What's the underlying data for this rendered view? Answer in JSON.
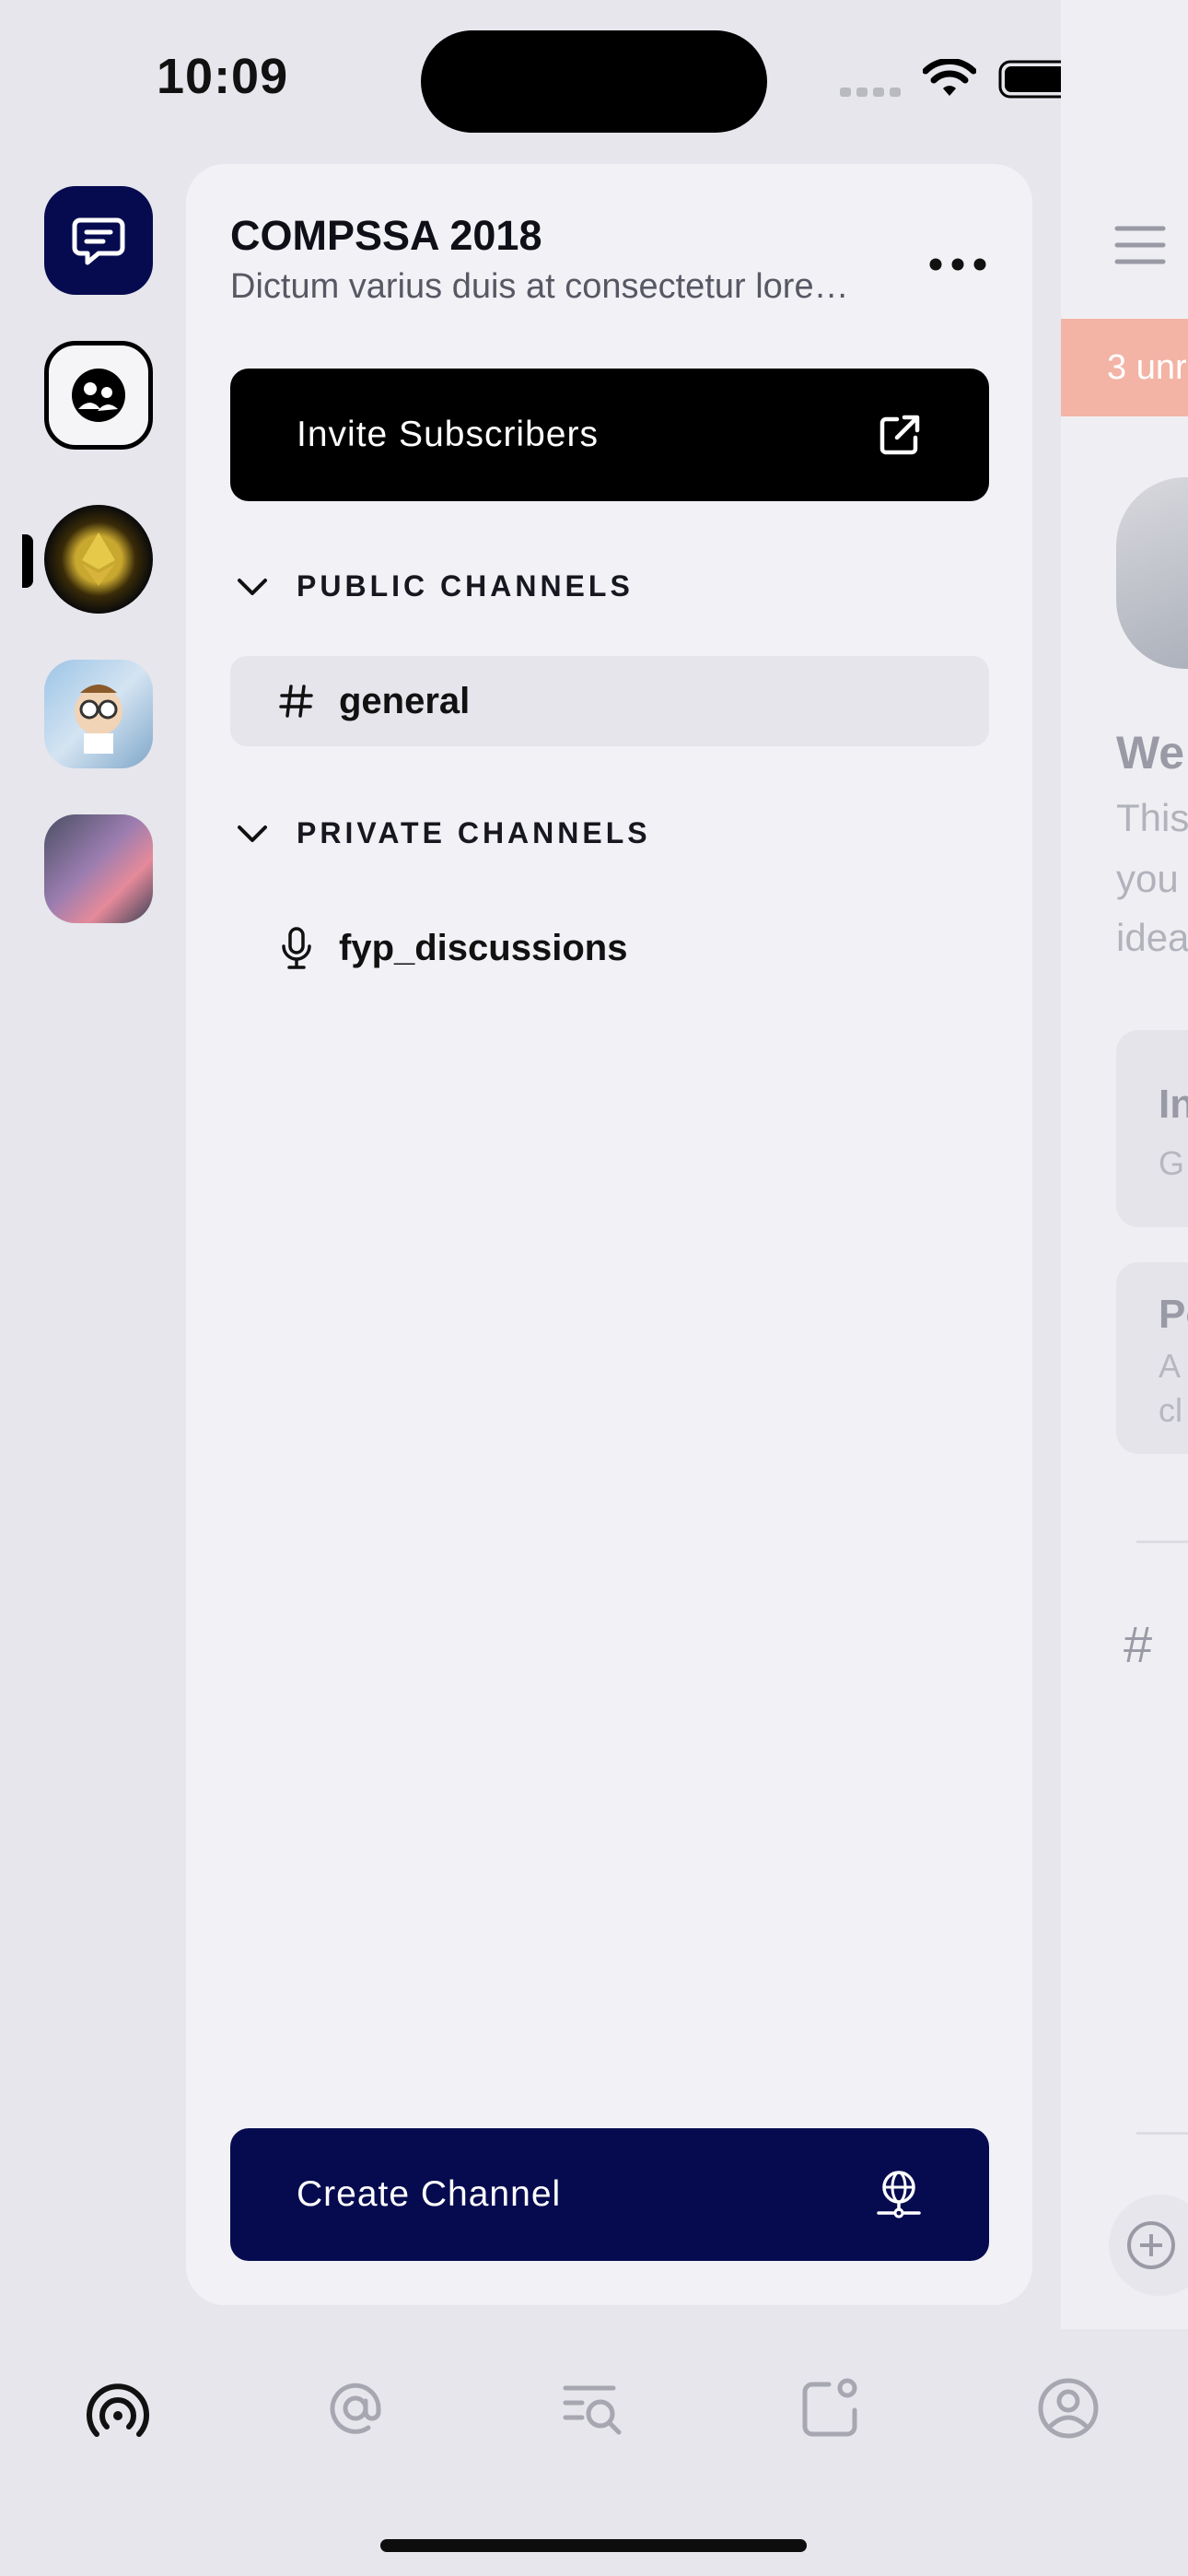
{
  "status_bar": {
    "time": "10:09"
  },
  "server": {
    "title": "COMPSSA 2018",
    "description": "Dictum varius duis at consectetur lorem donec massa sapien"
  },
  "invite_button": {
    "label": "Invite Subscribers"
  },
  "sections": [
    {
      "title": "PUBLIC CHANNELS",
      "channels": [
        {
          "name": "general",
          "type": "text"
        }
      ]
    },
    {
      "title": "PRIVATE CHANNELS",
      "channels": [
        {
          "name": "fyp_discussions",
          "type": "voice"
        }
      ]
    }
  ],
  "create_button": {
    "label": "Create Channel"
  },
  "background_screen": {
    "unread_banner": "3 unr",
    "welcome": "We",
    "body_lines": [
      "This",
      "you",
      "idea"
    ],
    "cards": [
      {
        "title": "In",
        "sub": "G"
      },
      {
        "title": "Po",
        "sub": "A",
        "sub2": "cl"
      }
    ],
    "hash": "#"
  },
  "colors": {
    "accent": "#060b50",
    "black": "#000000",
    "banner": "#f3b3a5"
  }
}
